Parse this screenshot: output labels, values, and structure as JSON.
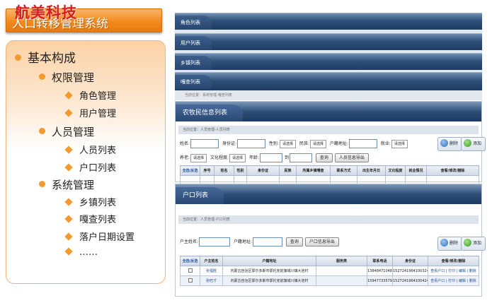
{
  "brand": "航美科技",
  "slide_title": "人口转移管理系统",
  "outline": [
    {
      "text": "基本构成",
      "level": 1
    },
    {
      "text": "权限管理",
      "level": 2
    },
    {
      "text": "角色管理",
      "level": 3
    },
    {
      "text": "用户管理",
      "level": 3
    },
    {
      "text": "人员管理",
      "level": 2
    },
    {
      "text": "人员列表",
      "level": 3
    },
    {
      "text": "户口列表",
      "level": 3
    },
    {
      "text": "系统管理",
      "level": 2
    },
    {
      "text": "乡镇列表",
      "level": 3
    },
    {
      "text": "嘎查列表",
      "level": 3
    },
    {
      "text": "落户日期设置",
      "level": 3
    },
    {
      "text": "……",
      "level": 3
    }
  ],
  "strips": {
    "role": "角色列表",
    "user": "用户列表",
    "town": "乡镇列表",
    "village": "嘎查列表",
    "village_crumb": "当前位置：系统管理-嘎查列表"
  },
  "farmer_panel": {
    "title": "农牧民信息列表",
    "crumb": "当前位置：人员管理-人员列表",
    "labels": {
      "name": "姓名:",
      "id": "身份证:",
      "gender": "性别:",
      "ethnic": "民族:",
      "hukou_addr": "户籍地址:",
      "employment": "就业:",
      "elderly": "养老:",
      "education": "文化程度:",
      "age": "年龄:",
      "to": "到"
    },
    "select_placeholder": "请选择",
    "query_btn": "查询",
    "export_btn": "人员信息导出",
    "delete_btn": "删除",
    "add_btn": "添加",
    "columns": [
      "全选/反选",
      "序号",
      "姓名",
      "性别",
      "身份证",
      "民族",
      "所属乡镇嘎查",
      "联系方式",
      "出生年月日",
      "文化程度",
      "就业情况",
      "查看/修改/删除"
    ]
  },
  "hukou_panel": {
    "title": "户口列表",
    "crumb": "当前位置：人员管理-户口列表",
    "label_head": "户主姓名:",
    "label_addr": "户籍地址:",
    "query_btn": "查询",
    "export_btn": "户口信息导出",
    "delete_btn": "删除",
    "add_btn": "添加",
    "columns": [
      "全选/反选",
      "户主姓名",
      "户籍地址",
      "服务类",
      "联系电话",
      "身份证",
      "查看/修改/删除"
    ],
    "rows": [
      {
        "name": "张福胜",
        "addr": "内蒙古自治区鄂尔多斯市鄂托克前旗城川镇大池村",
        "service": "",
        "phone": "13848471048",
        "id": "152724196410032410",
        "actions": "查看户口 | 打印 | 编辑 | 删除"
      },
      {
        "name": "张旺才",
        "addr": "内蒙古自治区鄂尔多斯市鄂托克前旗城川镇大池村",
        "service": "",
        "phone": "15947733579",
        "id": "152724196410042419",
        "actions": "查看户口 | 打印 | 编辑 | 删除"
      }
    ]
  }
}
